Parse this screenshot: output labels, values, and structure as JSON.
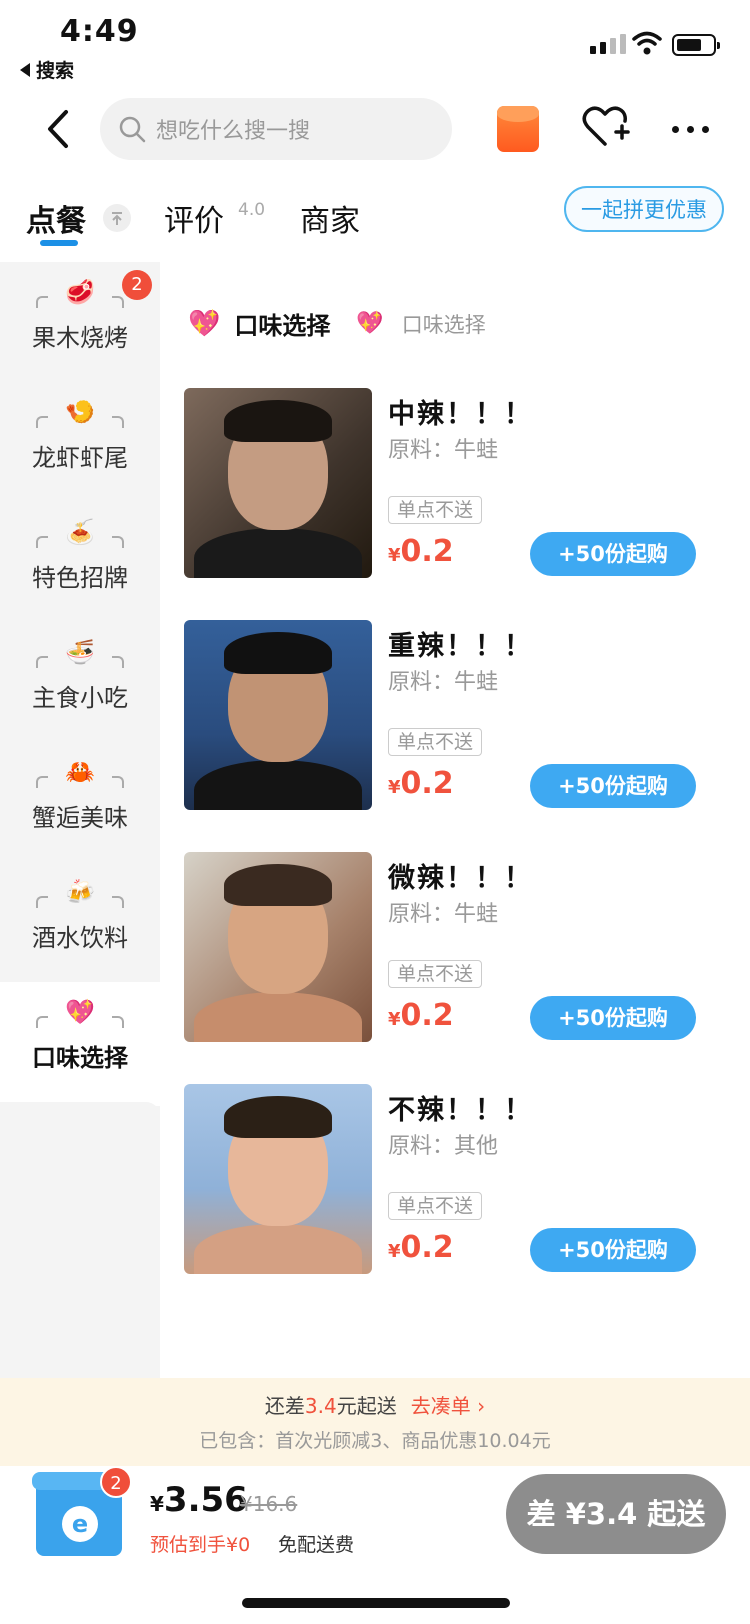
{
  "status": {
    "time": "4:49",
    "back_app": "搜索"
  },
  "nav": {
    "search_placeholder": "想吃什么搜一搜"
  },
  "tabs": {
    "order": "点餐",
    "reviews": "评价",
    "rating": "4.0",
    "merchant": "商家",
    "group_buy": "一起拼更优惠"
  },
  "categories": [
    {
      "emoji": "🥩",
      "label": "果木烧烤",
      "badge": "2"
    },
    {
      "emoji": "🍤",
      "label": "龙虾虾尾"
    },
    {
      "emoji": "🍝",
      "label": "特色招牌"
    },
    {
      "emoji": "🍜",
      "label": "主食小吃"
    },
    {
      "emoji": "🦀",
      "label": "蟹逅美味"
    },
    {
      "emoji": "🍻",
      "label": "酒水饮料"
    },
    {
      "emoji": "💖",
      "label": "口味选择"
    }
  ],
  "section": {
    "emoji": "💖",
    "title": "口味选择",
    "subtitle": "口味选择"
  },
  "items": [
    {
      "name": "中辣！！！",
      "ingredients": "原料：牛蛙",
      "tag": "单点不送",
      "currency": "¥",
      "price": "0.2",
      "button": "+50份起购"
    },
    {
      "name": "重辣！！！",
      "ingredients": "原料：牛蛙",
      "tag": "单点不送",
      "currency": "¥",
      "price": "0.2",
      "button": "+50份起购"
    },
    {
      "name": "微辣！！！",
      "ingredients": "原料：牛蛙",
      "tag": "单点不送",
      "currency": "¥",
      "price": "0.2",
      "button": "+50份起购"
    },
    {
      "name": "不辣！！！",
      "ingredients": "原料：其他",
      "tag": "单点不送",
      "currency": "¥",
      "price": "0.2",
      "button": "+50份起购"
    }
  ],
  "notice": {
    "prefix": "还差",
    "amount": "3.4",
    "suffix": "元起送",
    "action": "去凑单 ›",
    "detail": "已包含：首次光顾减3、商品优惠10.04元"
  },
  "cart": {
    "badge": "2",
    "currency": "¥",
    "total": "3.56",
    "original": "¥16.6",
    "estimate": "预估到手¥0",
    "delivery": "免配送费",
    "checkout": "差 ¥3.4 起送"
  },
  "colors": {
    "accent": "#3ea9f2",
    "price": "#f0523d",
    "notice_bg": "#fdf5e4"
  }
}
